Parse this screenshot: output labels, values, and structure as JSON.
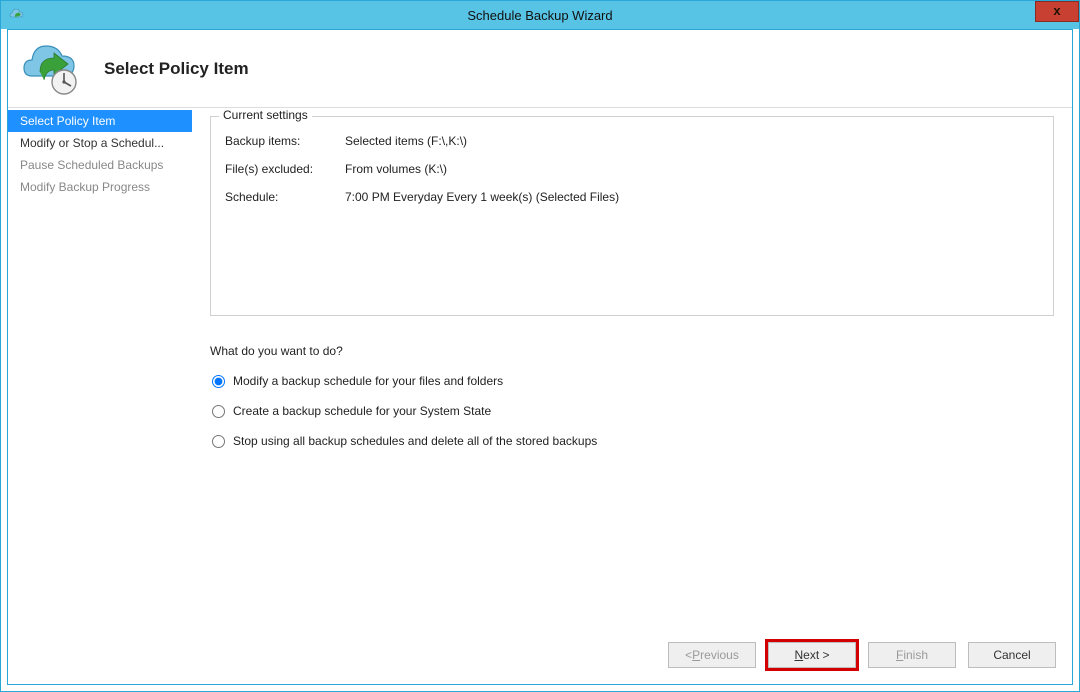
{
  "window": {
    "title": "Schedule Backup Wizard",
    "close_label": "x"
  },
  "header": {
    "title": "Select Policy Item"
  },
  "sidebar": {
    "items": [
      {
        "label": "Select Policy Item",
        "state": "selected"
      },
      {
        "label": "Modify or Stop a Schedul...",
        "state": "normal"
      },
      {
        "label": "Pause Scheduled Backups",
        "state": "disabled"
      },
      {
        "label": "Modify Backup Progress",
        "state": "disabled"
      }
    ]
  },
  "settings": {
    "legend": "Current settings",
    "backup_items_label": "Backup items:",
    "backup_items_value": "Selected items (F:\\,K:\\)",
    "excluded_label": "File(s) excluded:",
    "excluded_value": "From volumes (K:\\)",
    "schedule_label": "Schedule:",
    "schedule_value": "7:00 PM Everyday Every 1 week(s) (Selected Files)"
  },
  "question": "What do you want to do?",
  "options": {
    "opt1": "Modify a backup schedule for your files and folders",
    "opt2": "Create a backup schedule for your System State",
    "opt3": "Stop using all backup schedules and delete all of the stored backups"
  },
  "buttons": {
    "previous_pre": "< ",
    "previous_mn": "P",
    "previous_post": "revious",
    "next_mn": "N",
    "next_post": "ext >",
    "finish_mn": "F",
    "finish_post": "inish",
    "cancel": "Cancel"
  }
}
